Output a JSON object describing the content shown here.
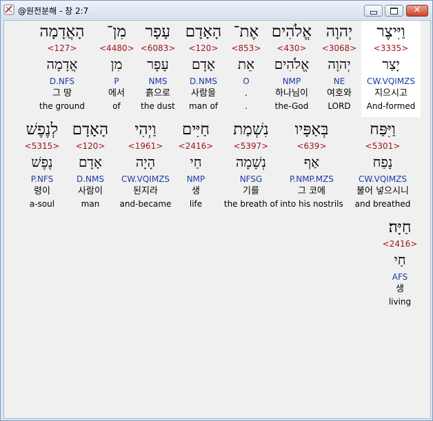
{
  "window": {
    "title": "@원전분해 - 창 2:7",
    "close_glyph": "✕"
  },
  "lines": [
    {
      "words": [
        {
          "heb": "הָאֲדָמָה",
          "strong": "<127>",
          "lemma": "אֲדָמָה",
          "morph": "D.NFS",
          "kor": "그 땅",
          "eng": "the ground"
        },
        {
          "heb": "מִן־",
          "strong": "<4480>",
          "lemma": "מִן",
          "morph": "P",
          "kor": "에서",
          "eng": "of"
        },
        {
          "heb": "עָפָר",
          "strong": "<6083>",
          "lemma": "עָפָר",
          "morph": "NMS",
          "kor": "흙으로",
          "eng": "the dust"
        },
        {
          "heb": "הָאָדָם",
          "strong": "<120>",
          "lemma": "אָדָם",
          "morph": "D.NMS",
          "kor": "사람을",
          "eng": "man of"
        },
        {
          "heb": "אֶת־",
          "strong": "<853>",
          "lemma": "אֵת",
          "morph": "O",
          "kor": ".",
          "eng": "."
        },
        {
          "heb": "אֱלֹהִים",
          "strong": "<430>",
          "lemma": "אֱלֹהִים",
          "morph": "NMP",
          "kor": "하나님이",
          "eng": "the-God"
        },
        {
          "heb": "יְהוָה",
          "strong": "<3068>",
          "lemma": "יְהוָה",
          "morph": "NE",
          "kor": "여호와",
          "eng": "LORD"
        },
        {
          "heb": "וַיִּיצֶר",
          "strong": "<3335>",
          "lemma": "יָצַר",
          "morph": "CW.VQIMZS",
          "kor": "지으시고",
          "eng": "And-formed"
        }
      ]
    },
    {
      "words": [
        {
          "heb": "לְנֶפֶשׁ",
          "strong": "<5315>",
          "lemma": "נֶפֶשׁ",
          "morph": "P.NFS",
          "kor": "령이",
          "eng": "a-soul"
        },
        {
          "heb": "הָאָדָם",
          "strong": "<120>",
          "lemma": "אָדָם",
          "morph": "D.NMS",
          "kor": "사람이",
          "eng": "man"
        },
        {
          "heb": "וַיְהִי",
          "strong": "<1961>",
          "lemma": "הָיָה",
          "morph": "CW.VQIMZS",
          "kor": "된지라",
          "eng": "and-became"
        },
        {
          "heb": "חַיִּים",
          "strong": "<2416>",
          "lemma": "חַי",
          "morph": "NMP",
          "kor": "생",
          "eng": "life"
        },
        {
          "heb": "נִשְׁמַת",
          "strong": "<5397>",
          "lemma": "נְשָׁמָה",
          "morph": "NFSG",
          "kor": "기를",
          "eng": "the breath of"
        },
        {
          "heb": "בְּאַפָּיו",
          "strong": "<639>",
          "lemma": "אַף",
          "morph": "P.NMP.MZS",
          "kor": "그 코에",
          "eng": "into his nostrils"
        },
        {
          "heb": "וַיִּפַּח",
          "strong": "<5301>",
          "lemma": "נָפַח",
          "morph": "CW.VQIMZS",
          "kor": "불어 넣으시니",
          "eng": "and breathed"
        }
      ]
    },
    {
      "words": [
        {
          "heb": "חַיָּה׃",
          "strong": "<2416>",
          "lemma": "חַי",
          "morph": "AFS",
          "kor": "생",
          "eng": "living"
        }
      ]
    }
  ]
}
